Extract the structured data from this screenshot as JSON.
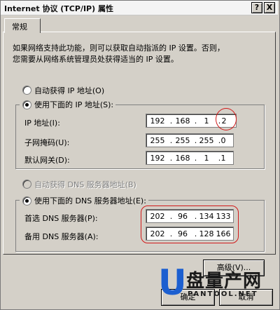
{
  "window": {
    "title": "Internet 协议 (TCP/IP) 属性"
  },
  "titlebar_buttons": {
    "help": "?",
    "close": "X"
  },
  "tabs": [
    {
      "label": "常规"
    }
  ],
  "intro_text": [
    "如果网络支持此功能，则可以获取自动指派的 IP 设置。否则，",
    "您需要从网络系统管理员处获得适当的 IP 设置。"
  ],
  "ip_mode": {
    "auto_label": "自动获得 IP 地址(O)",
    "manual_label": "使用下面的 IP 地址(S):",
    "selected": "manual"
  },
  "ip_fields": {
    "ip_label": "IP 地址(I):",
    "ip_value": [
      "192",
      "168",
      "1",
      "2"
    ],
    "mask_label": "子网掩码(U):",
    "mask_value": [
      "255",
      "255",
      "255",
      "0"
    ],
    "gateway_label": "默认网关(D):",
    "gateway_value": [
      "192",
      "168",
      "1",
      "1"
    ]
  },
  "dns_mode": {
    "auto_label": "自动获得 DNS 服务器地址(B)",
    "manual_label": "使用下面的 DNS 服务器地址(E):",
    "selected": "manual",
    "auto_disabled": true
  },
  "dns_fields": {
    "preferred_label": "首选 DNS 服务器(P):",
    "preferred_value": [
      "202",
      "96",
      "134",
      "133"
    ],
    "alternate_label": "备用 DNS 服务器(A):",
    "alternate_value": [
      "202",
      "96",
      "128",
      "166"
    ]
  },
  "buttons": {
    "advanced": "高级(V)...",
    "ok": "确定",
    "cancel": "取消"
  },
  "watermark": {
    "text": "盘量产网",
    "sub": "PANTOOL.NET",
    "colors": {
      "u_letter": "#1c5fd0",
      "text": "#1a1a1a"
    }
  },
  "colors": {
    "annotation": "#d21a1a"
  }
}
